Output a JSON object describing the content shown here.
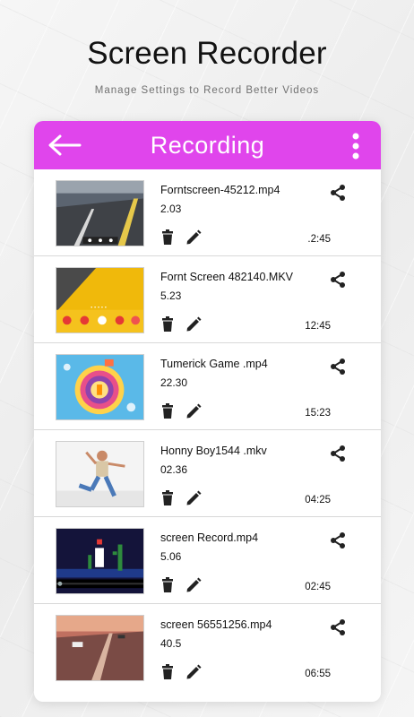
{
  "header": {
    "title": "Screen Recorder",
    "subtitle": "Manage Settings to Record Better Videos"
  },
  "appbar": {
    "title": "Recording",
    "color": "#e045ec",
    "back_icon": "arrow-left-icon",
    "menu_icon": "more-vertical-icon"
  },
  "recordings": [
    {
      "name": "Forntscreen-45212.mp4",
      "size": "2.03",
      "duration": ".2:45"
    },
    {
      "name": "Fornt Screen 482140.MKV",
      "size": "5.23",
      "duration": "12:45"
    },
    {
      "name": "Tumerick Game .mp4",
      "size": "22.30",
      "duration": "15:23"
    },
    {
      "name": "Honny Boy1544 .mkv",
      "size": "02.36",
      "duration": "04:25"
    },
    {
      "name": "screen Record.mp4",
      "size": "5.06",
      "duration": "02:45"
    },
    {
      "name": "screen 56551256.mp4",
      "size": "40.5",
      "duration": "06:55"
    }
  ]
}
